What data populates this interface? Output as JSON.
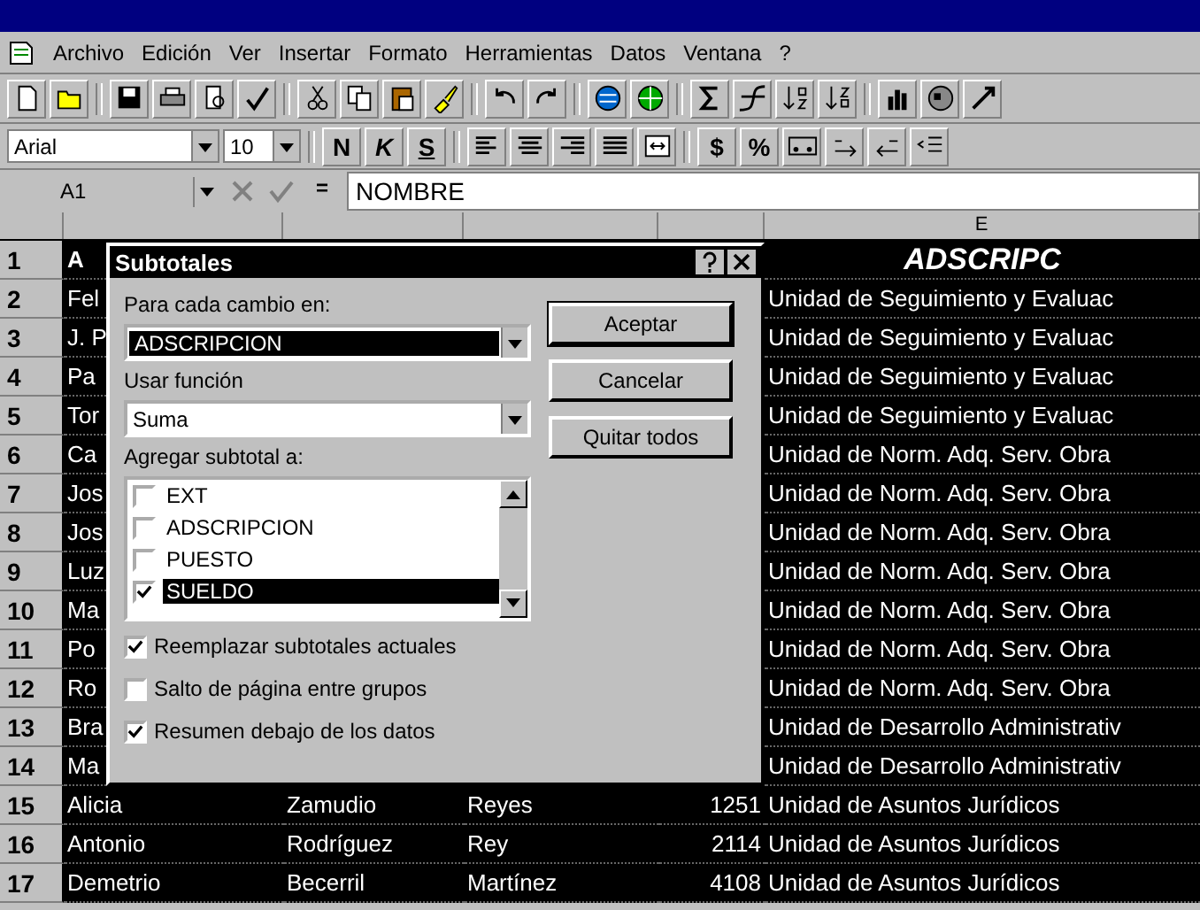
{
  "menu": [
    "Archivo",
    "Edición",
    "Ver",
    "Insertar",
    "Formato",
    "Herramientas",
    "Datos",
    "Ventana",
    "?"
  ],
  "format_toolbar": {
    "font": "Arial",
    "size": "10",
    "style_buttons": [
      "N",
      "K",
      "S"
    ],
    "number_buttons": [
      "$",
      "%"
    ]
  },
  "formula_bar": {
    "name_box": "A1",
    "equals": "=",
    "value": "NOMBRE"
  },
  "column_header": "E",
  "rows": [
    {
      "number": "1",
      "kind": "header",
      "a": "A",
      "e": "ADSCRIPC"
    },
    {
      "number": "2",
      "kind": "data",
      "a": "Fel",
      "e": "Unidad de Seguimiento y Evaluac"
    },
    {
      "number": "3",
      "kind": "data",
      "a": "J. P",
      "e": "Unidad de Seguimiento y Evaluac"
    },
    {
      "number": "4",
      "kind": "data",
      "a": "Pa",
      "e": "Unidad de Seguimiento y Evaluac"
    },
    {
      "number": "5",
      "kind": "data",
      "a": "Tor",
      "e": "Unidad de Seguimiento y Evaluac"
    },
    {
      "number": "6",
      "kind": "data",
      "a": "Ca",
      "e": "Unidad de Norm. Adq. Serv. Obra"
    },
    {
      "number": "7",
      "kind": "data",
      "a": "Jos",
      "e": "Unidad de Norm. Adq. Serv. Obra"
    },
    {
      "number": "8",
      "kind": "data",
      "a": "Jos",
      "e": "Unidad de Norm. Adq. Serv. Obra"
    },
    {
      "number": "9",
      "kind": "data",
      "a": "Luz",
      "e": "Unidad de Norm. Adq. Serv. Obra"
    },
    {
      "number": "10",
      "kind": "data",
      "a": "Ma",
      "e": "Unidad de Norm. Adq. Serv. Obra"
    },
    {
      "number": "11",
      "kind": "data",
      "a": "Po",
      "e": "Unidad de Norm. Adq. Serv. Obra"
    },
    {
      "number": "12",
      "kind": "data",
      "a": "Ro",
      "e": "Unidad de Norm. Adq. Serv. Obra"
    },
    {
      "number": "13",
      "kind": "data",
      "a": "Bra",
      "e": "Unidad de Desarrollo Administrativ"
    },
    {
      "number": "14",
      "kind": "data",
      "a": "Ma",
      "e": "Unidad de Desarrollo Administrativ"
    },
    {
      "number": "15",
      "kind": "data",
      "a": "Alicia",
      "b": "Zamudio",
      "c": "Reyes",
      "d": "1251",
      "e": "Unidad de Asuntos Jurídicos"
    },
    {
      "number": "16",
      "kind": "data",
      "a": "Antonio",
      "b": "Rodríguez",
      "c": "Rey",
      "d": "2114",
      "e": "Unidad de Asuntos Jurídicos"
    },
    {
      "number": "17",
      "kind": "data",
      "a": "Demetrio",
      "b": "Becerril",
      "c": "Martínez",
      "d": "4108",
      "e": "Unidad de Asuntos Jurídicos"
    }
  ],
  "dialog": {
    "title": "Subtotales",
    "change_label": "Para cada cambio en:",
    "change_value": "ADSCRIPCION",
    "function_label": "Usar función",
    "function_value": "Suma",
    "add_label": "Agregar subtotal a:",
    "fields": [
      {
        "label": "EXT",
        "checked": false,
        "selected": false
      },
      {
        "label": "ADSCRIPCION",
        "checked": false,
        "selected": false
      },
      {
        "label": "PUESTO",
        "checked": false,
        "selected": false
      },
      {
        "label": "SUELDO",
        "checked": true,
        "selected": true
      }
    ],
    "options": [
      {
        "label": "Reemplazar subtotales actuales",
        "checked": true
      },
      {
        "label": "Salto de página entre grupos",
        "checked": false
      },
      {
        "label": "Resumen debajo de los datos",
        "checked": true
      }
    ],
    "buttons": [
      "Aceptar",
      "Cancelar",
      "Quitar todos"
    ]
  }
}
